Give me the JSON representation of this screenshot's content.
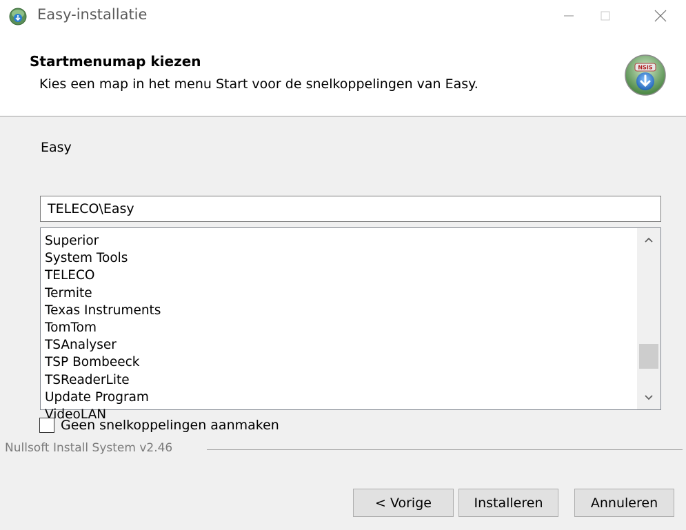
{
  "window": {
    "title": "Easy-installatie"
  },
  "header": {
    "title": "Startmenumap kiezen",
    "subtitle": "Kies een map in het menu Start voor de snelkoppelingen van Easy."
  },
  "body": {
    "folder_label": "Easy",
    "folder_value": "TELECO\\Easy",
    "list_items": [
      "Superior",
      "System Tools",
      "TELECO",
      "Termite",
      "Texas Instruments",
      "TomTom",
      "TSAnalyser",
      "TSP Bombeeck",
      "TSReaderLite",
      "Update Program",
      "VideoLAN"
    ],
    "scroll_position": 0.85,
    "checkbox_label": "Geen snelkoppelingen aanmaken",
    "checkbox_checked": false
  },
  "branding": {
    "text": "Nullsoft Install System v2.46"
  },
  "buttons": {
    "back": "< Vorige",
    "install": "Installeren",
    "cancel": "Annuleren"
  },
  "icons": {
    "app": "nsis-installer-icon",
    "header": "nsis-installer-icon"
  }
}
